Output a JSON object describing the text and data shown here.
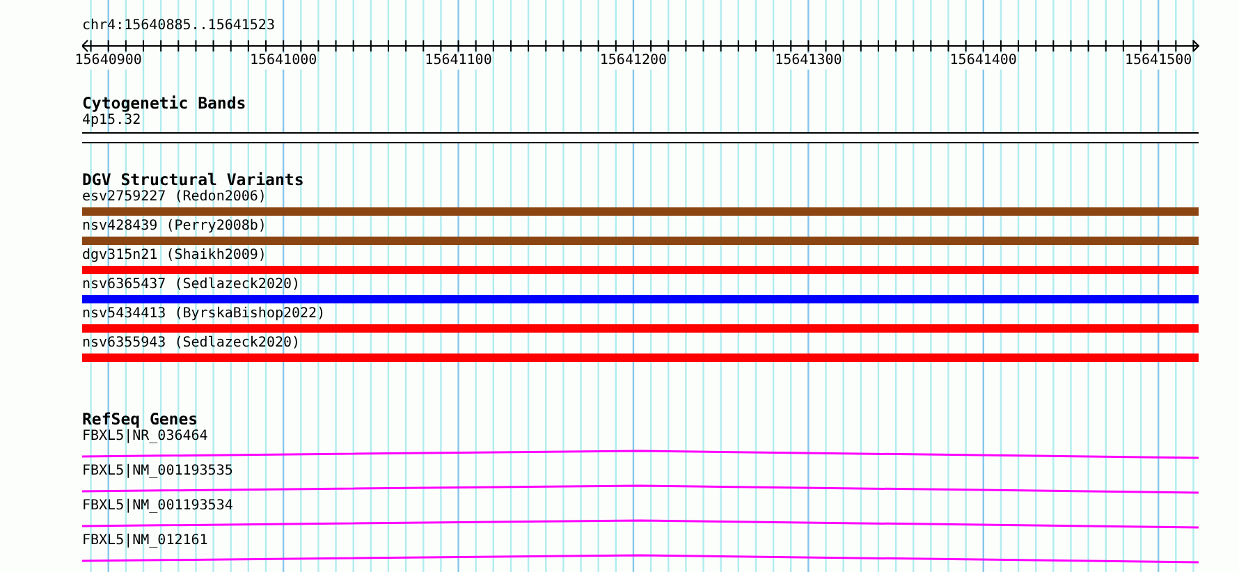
{
  "ruler": {
    "location": "chr4:15640885..15641523",
    "ticks": [
      "15640900",
      "15641000",
      "15641100",
      "15641200",
      "15641300",
      "15641400",
      "15641500"
    ]
  },
  "tracks": [
    {
      "kind": "band",
      "title": "Cytogenetic Bands",
      "features": [
        {
          "label": "4p15.32"
        }
      ]
    },
    {
      "kind": "variant",
      "title": "DGV Structural Variants",
      "features": [
        {
          "label": "esv2759227 (Redon2006)",
          "color": "#8b4513"
        },
        {
          "label": "nsv428439 (Perry2008b)",
          "color": "#8b4513"
        },
        {
          "label": "dgv315n21 (Shaikh2009)",
          "color": "#ff0000"
        },
        {
          "label": "nsv6365437 (Sedlazeck2020)",
          "color": "#0000ff"
        },
        {
          "label": "nsv5434413 (ByrskaBishop2022)",
          "color": "#ff0000"
        },
        {
          "label": "nsv6355943 (Sedlazeck2020)",
          "color": "#ff0000"
        }
      ]
    },
    {
      "kind": "gene",
      "title": "RefSeq Genes",
      "features": [
        {
          "label": "FBXL5|NR_036464"
        },
        {
          "label": "FBXL5|NM_001193535"
        },
        {
          "label": "FBXL5|NM_001193534"
        },
        {
          "label": "FBXL5|NM_012161"
        }
      ]
    }
  ]
}
